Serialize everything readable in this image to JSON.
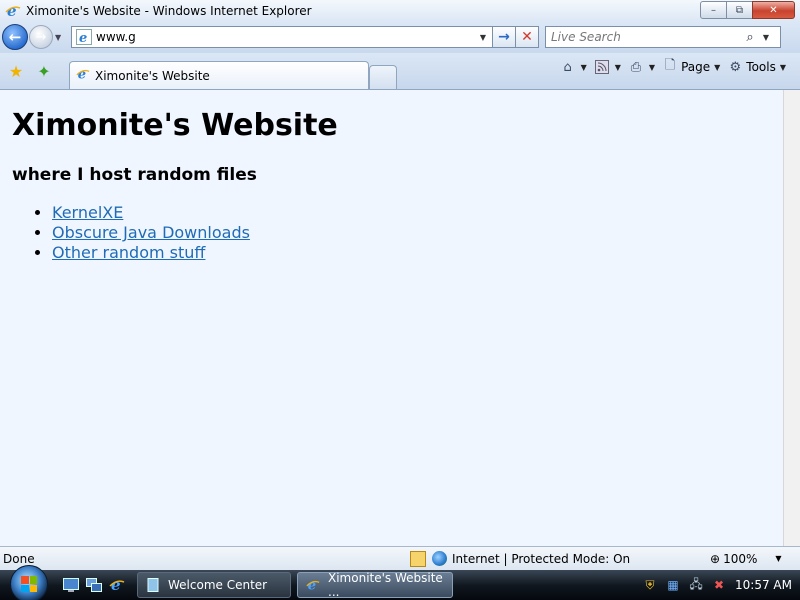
{
  "window": {
    "title": "Ximonite's Website - Windows Internet Explorer",
    "controls": {
      "minimize": "–",
      "restore": "⧉",
      "close": "✕"
    }
  },
  "address_bar": {
    "value": "www.g",
    "go_glyph": "→",
    "stop_glyph": "✕"
  },
  "search": {
    "placeholder": "Live Search"
  },
  "tab": {
    "label": "Ximonite's Website"
  },
  "command_bar": {
    "home_icon": "home-icon",
    "feeds_icon": "rss-feed-icon",
    "print_icon": "print-icon",
    "page_label": "Page",
    "tools_label": "Tools"
  },
  "page": {
    "heading": "Ximonite's Website",
    "subheading": "where I host random files",
    "links": [
      {
        "label": "KernelXE"
      },
      {
        "label": "Obscure Java Downloads"
      },
      {
        "label": "Other random stuff"
      }
    ]
  },
  "status_bar": {
    "status": "Done",
    "zone": "Internet | Protected Mode: On",
    "zoom": "100%"
  },
  "taskbar": {
    "tasks": [
      {
        "label": "Welcome Center"
      },
      {
        "label": "Ximonite's Website ..."
      }
    ],
    "clock": "10:57 AM"
  },
  "colors": {
    "link": "#1f6bb5",
    "content_bg": "#eff6ff",
    "close_button": "#c8432f"
  }
}
